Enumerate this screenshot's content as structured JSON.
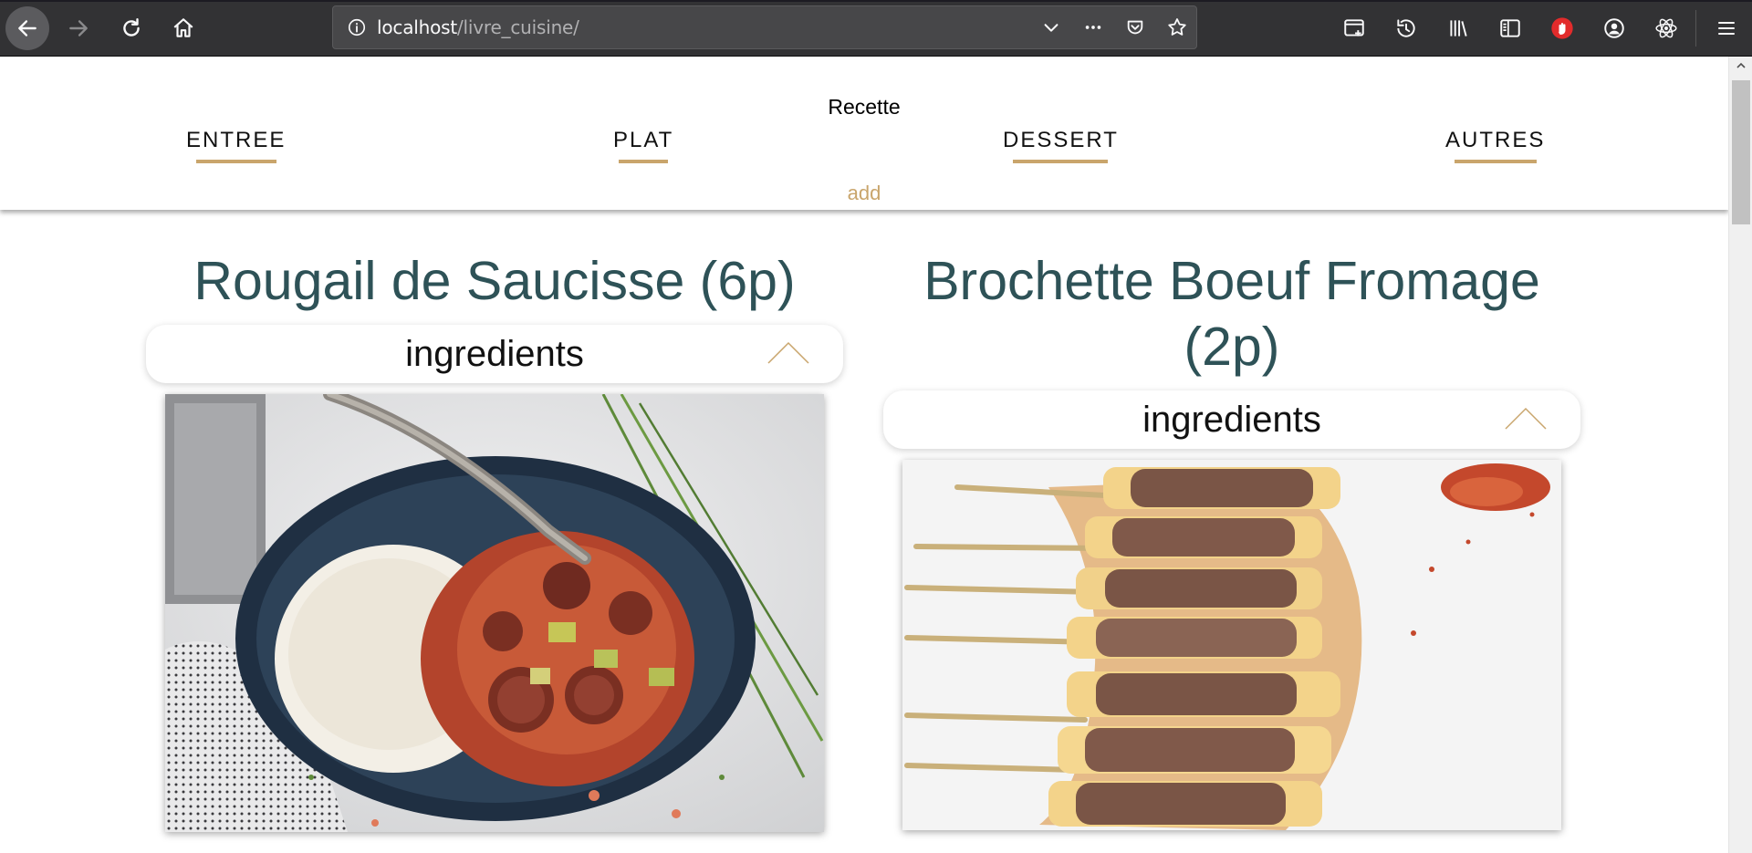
{
  "browser": {
    "url_host": "localhost",
    "url_path": "/livre_cuisine/"
  },
  "header": {
    "brand": "Recette",
    "menu": {
      "entree": "ENTREE",
      "plat": "PLAT",
      "dessert": "DESSERT",
      "autres": "AUTRES"
    },
    "add": "add"
  },
  "recipes": [
    {
      "title": "Rougail de Saucisse (6p)",
      "ingredients_label": "ingredients"
    },
    {
      "title": "Brochette Boeuf Fromage (2p)",
      "ingredients_label": "ingredients"
    }
  ],
  "colors": {
    "accent": "#c9a56c",
    "title": "#2e5257",
    "chrome": "#323234"
  }
}
